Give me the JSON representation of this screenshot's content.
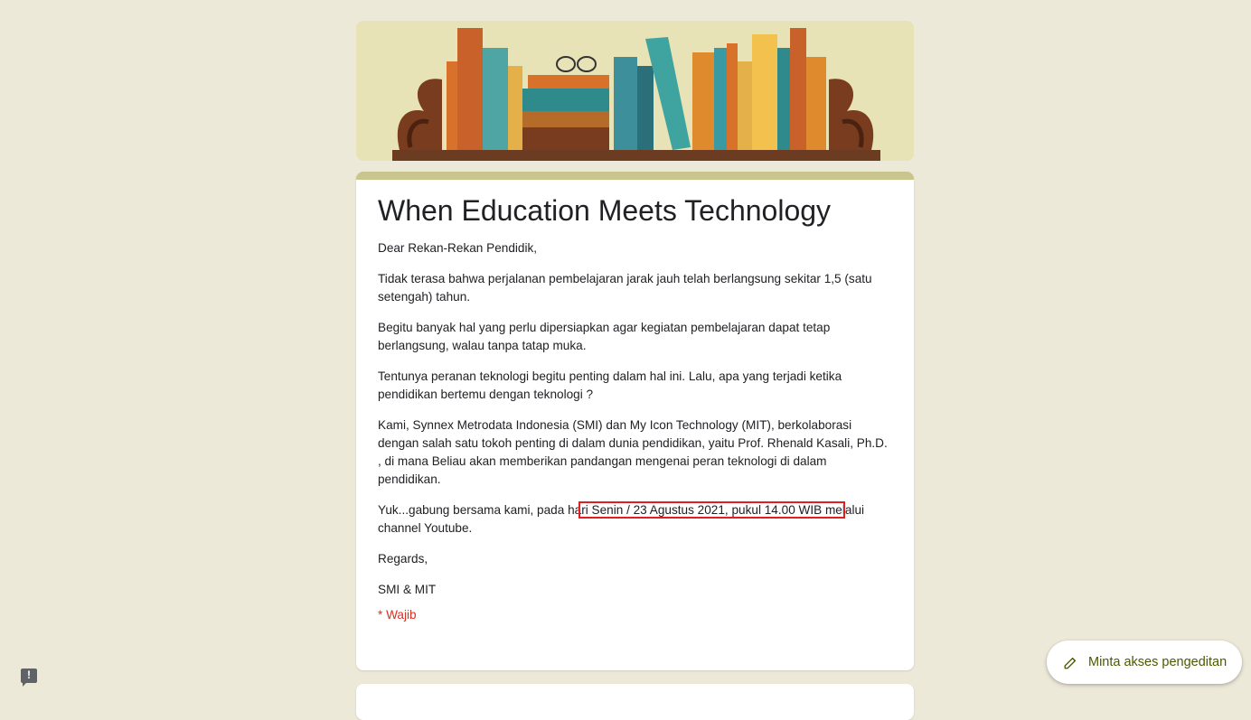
{
  "form": {
    "title": "When Education Meets Technology",
    "description": {
      "greeting": "Dear Rekan-Rekan Pendidik,",
      "p1": "Tidak terasa bahwa perjalanan pembelajaran jarak jauh telah berlangsung sekitar 1,5 (satu setengah) tahun.",
      "p2": "Begitu banyak hal yang perlu dipersiapkan agar kegiatan pembelajaran dapat tetap berlangsung, walau tanpa tatap muka.",
      "p3": "Tentunya peranan teknologi begitu penting dalam hal ini. Lalu, apa yang terjadi ketika pendidikan bertemu dengan teknologi ?",
      "p4": "Kami, Synnex Metrodata Indonesia (SMI) dan My Icon Technology (MIT), berkolaborasi dengan salah satu tokoh penting di dalam dunia pendidikan, yaitu Prof. Rhenald Kasali, Ph.D. , di mana Beliau akan memberikan pandangan mengenai peran teknologi di dalam pendidikan.",
      "p5_before": "Yuk...gabung bersama kami, pada ha",
      "p5_highlight": "ri Senin / 23 Agustus 2021, pukul 14.00 WIB me",
      "p5_after": "lalui channel Youtube.",
      "regards": "Regards,",
      "signature": "SMI & MIT"
    },
    "required_note": "* Wajib"
  },
  "edit_button": {
    "label": "Minta akses pengeditan",
    "icon": "pencil-icon"
  },
  "feedback_button": {
    "icon": "feedback-icon",
    "glyph": "!"
  },
  "colors": {
    "background": "#ede9d9",
    "accent": "#c9c58f",
    "required": "#d93025",
    "highlight_box": "#e02020",
    "button_text": "#4a5a00"
  }
}
